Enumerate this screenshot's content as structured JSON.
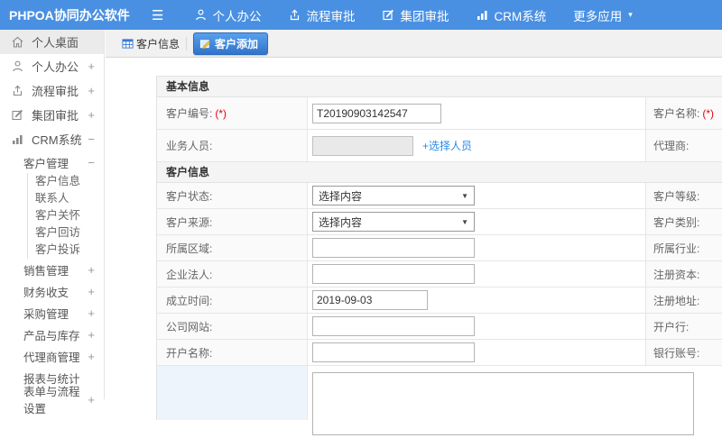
{
  "colors": {
    "header_blue": "#4a90e2",
    "tab_active_top": "#58a0ee",
    "tab_active_bottom": "#3173cb",
    "link_blue": "#2b8bea",
    "required_red": "#e60012",
    "highlight_cell": "#edf4fb"
  },
  "icons": {
    "hamburger": "☰",
    "chevron_down": "▾",
    "select_caret": "▼"
  },
  "topbar": {
    "logo": "PHPOA协同办公软件",
    "menu": [
      {
        "icon": "user-icon",
        "label": "个人办公"
      },
      {
        "icon": "process-icon",
        "label": "流程审批"
      },
      {
        "icon": "edit-icon",
        "label": "集团审批"
      },
      {
        "icon": "chart-icon",
        "label": "CRM系统"
      },
      {
        "icon": "chevron-down-icon",
        "label": "更多应用"
      }
    ]
  },
  "sidebar": {
    "items": [
      {
        "label": "个人桌面",
        "expand": ""
      },
      {
        "label": "个人办公",
        "expand": "+"
      },
      {
        "label": "流程审批",
        "expand": "+"
      },
      {
        "label": "集团审批",
        "expand": "+"
      },
      {
        "label": "CRM系统",
        "expand": "−"
      }
    ],
    "crm": {
      "customer_group": {
        "label": "客户管理",
        "expand": "−"
      },
      "customer_items": [
        {
          "label": "客户信息"
        },
        {
          "label": "联系人"
        },
        {
          "label": "客户关怀"
        },
        {
          "label": "客户回访"
        },
        {
          "label": "客户投诉"
        }
      ],
      "groups": [
        {
          "label": "销售管理",
          "expand": "+"
        },
        {
          "label": "财务收支",
          "expand": "+"
        },
        {
          "label": "采购管理",
          "expand": "+"
        },
        {
          "label": "产品与库存",
          "expand": "+"
        },
        {
          "label": "代理商管理",
          "expand": "+"
        },
        {
          "label": "报表与统计",
          "expand": ""
        },
        {
          "label": "表单与流程设置",
          "expand": "+"
        }
      ]
    }
  },
  "tabs": {
    "tab1": "客户信息",
    "tab2": "客户添加"
  },
  "form": {
    "basic": {
      "title": "基本信息",
      "rows": [
        {
          "label1": "客户编号:",
          "req1": "(*)",
          "value1": "T20190903142547",
          "label2": "客户名称:",
          "req2": "(*)"
        },
        {
          "label1": "业务人员:",
          "value1": "",
          "link": "+选择人员",
          "label2": "代理商:"
        }
      ]
    },
    "customer": {
      "title": "客户信息",
      "rows": [
        {
          "label1": "客户状态:",
          "select1": "选择内容",
          "label2": "客户等级:"
        },
        {
          "label1": "客户来源:",
          "select1": "选择内容",
          "label2": "客户类别:"
        },
        {
          "label1": "所属区域:",
          "value1": "",
          "label2": "所属行业:"
        },
        {
          "label1": "企业法人:",
          "value1": "",
          "label2": "注册资本:"
        },
        {
          "label1": "成立时间:",
          "value1": "2019-09-03",
          "label2": "注册地址:"
        },
        {
          "label1": "公司网站:",
          "value1": "",
          "label2": "开户行:"
        },
        {
          "label1": "开户名称:",
          "value1": "",
          "label2": "银行账号:"
        }
      ]
    }
  }
}
